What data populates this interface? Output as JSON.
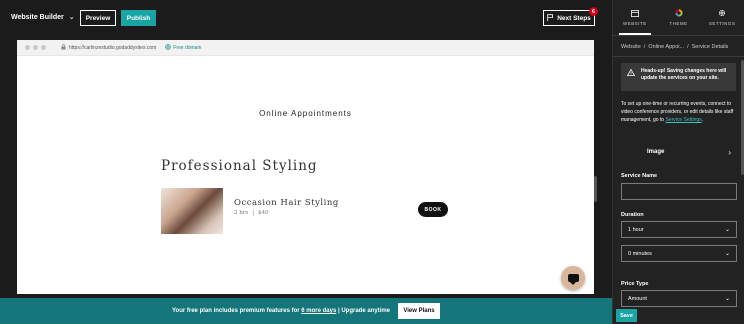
{
  "topbar": {
    "app_name": "Website Builder",
    "preview_label": "Preview",
    "publish_label": "Publish",
    "next_steps_label": "Next Steps",
    "next_steps_count": "6"
  },
  "browser": {
    "url": "https://carlinzestudio.godaddysites.com",
    "domain_label": "Free domain"
  },
  "site": {
    "page_heading": "Online Appointments",
    "service_section_title": "Professional Styling",
    "service": {
      "name": "Occasion Hair Styling",
      "duration": "2 hrs",
      "separator": "|",
      "price": "$40",
      "book_label": "BOOK"
    }
  },
  "banner": {
    "text_before": "Your free plan includes premium features for",
    "link_text": "6 more days",
    "text_after": "| Upgrade anytime",
    "button_label": "View Plans"
  },
  "panel": {
    "tabs": [
      {
        "label": "WEBSITE",
        "icon": "layout-icon",
        "active": true
      },
      {
        "label": "THEME",
        "icon": "theme-palette-icon",
        "active": false
      },
      {
        "label": "SETTINGS",
        "icon": "gear-icon",
        "active": false
      }
    ],
    "breadcrumb": {
      "items": [
        "Website",
        "Online Appoi...",
        "Service Details"
      ],
      "separator": "/"
    },
    "alert_text": "Heads-up! Saving changes here will update the services on your site.",
    "info_text": "To set up one-time or recurring events, connect to video conference providers, or edit details like staff management, go to",
    "info_link": "Service Settings",
    "info_suffix": ".",
    "image_row_label": "Image",
    "service_name_label": "Service Name",
    "service_name_value": "",
    "duration_label": "Duration",
    "duration_hours": "1 hour",
    "duration_minutes": "0 minutes",
    "price_type_label": "Price Type",
    "price_type_value": "Amount",
    "save_label": "Save"
  },
  "colors": {
    "accent": "#1aa4a4",
    "banner": "#14757a",
    "badge": "#d0021b",
    "link": "#3ec2c2"
  }
}
